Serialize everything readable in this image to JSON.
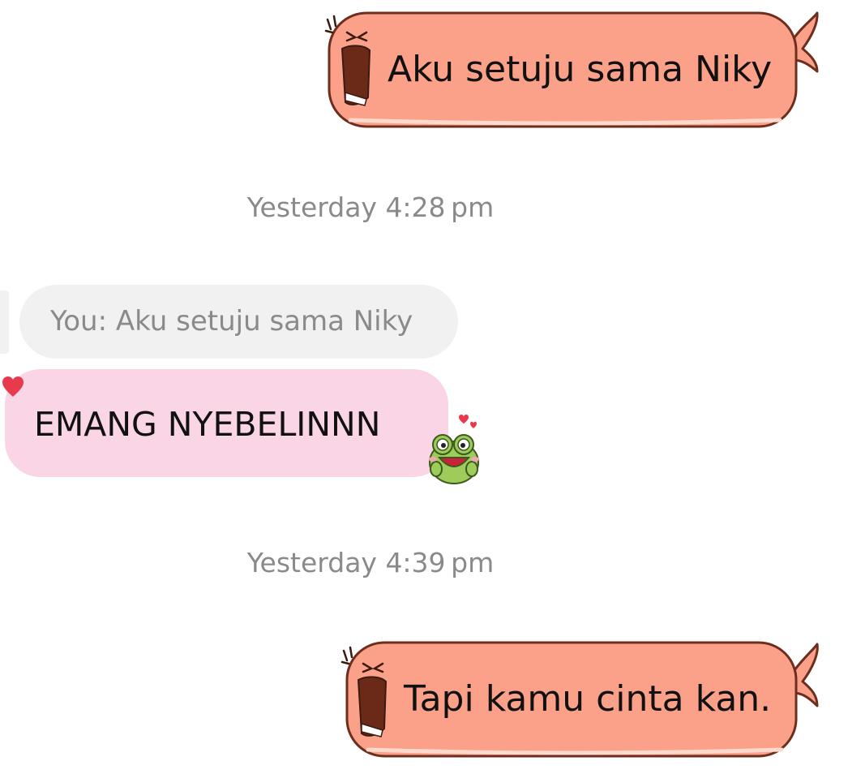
{
  "messages": {
    "sent_1": {
      "text": "Aku setuju sama Niky"
    },
    "timestamp_1": {
      "text": "Yesterday 4:28 pm"
    },
    "reply": {
      "quote": "You: Aku setuju sama Niky",
      "text": "EMANG NYEBELINNN"
    },
    "timestamp_2": {
      "text": "Yesterday 4:39 pm"
    },
    "sent_2": {
      "text": "Tapi kamu cinta kan."
    }
  },
  "colors": {
    "sent_bubble_fill": "#fca189",
    "sent_bubble_stroke": "#6e2e1d",
    "received_bubble": "#fad5e5",
    "quote_bubble": "#f1f1f1",
    "timestamp": "#8a8a8a",
    "heart": "#e8394d",
    "sticker_green": "#9dcc5a"
  },
  "icons": {
    "sent_bubble_decor": "shouting-mouth-icon",
    "reaction": "heart-icon",
    "sticker": "frog-sticker-icon"
  }
}
